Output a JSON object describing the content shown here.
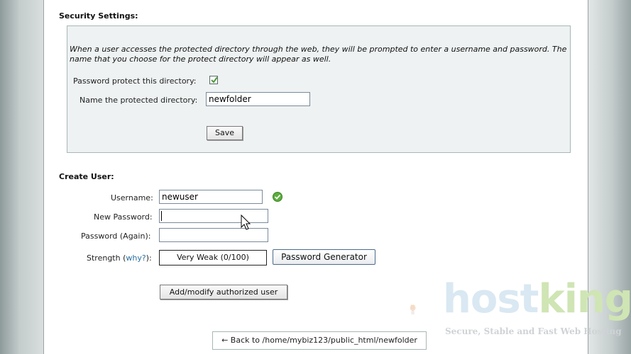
{
  "security": {
    "title": "Security Settings:",
    "description": "When a user accesses the protected directory through the web, they will be prompted to enter a username and password. The name that you choose for the protect directory will appear as well.",
    "protect_label": "Password protect this directory:",
    "protect_checked": true,
    "name_label": "Name the protected directory:",
    "name_value": "newfolder",
    "save_label": "Save"
  },
  "create_user": {
    "title": "Create User:",
    "username_label": "Username:",
    "username_value": "newuser",
    "new_password_label": "New Password:",
    "new_password_value": "",
    "password_again_label": "Password (Again):",
    "password_again_value": "",
    "strength_label_prefix": "Strength (",
    "strength_why": "why?",
    "strength_label_suffix": "):",
    "strength_value": "Very Weak (0/100)",
    "generator_label": "Password Generator",
    "submit_label": "Add/modify authorized user"
  },
  "footer": {
    "back_link": "← Back to /home/mybiz123/public_html/newfolder"
  },
  "watermark": {
    "brand_part1": "host",
    "brand_part2": "king",
    "tagline": "Secure, Stable and Fast Web Hosting"
  },
  "colors": {
    "panel_bg": "#eef2f2",
    "panel_border": "#a9b6b6",
    "link": "#2a6fa0",
    "check_green": "#4f9a3a"
  }
}
